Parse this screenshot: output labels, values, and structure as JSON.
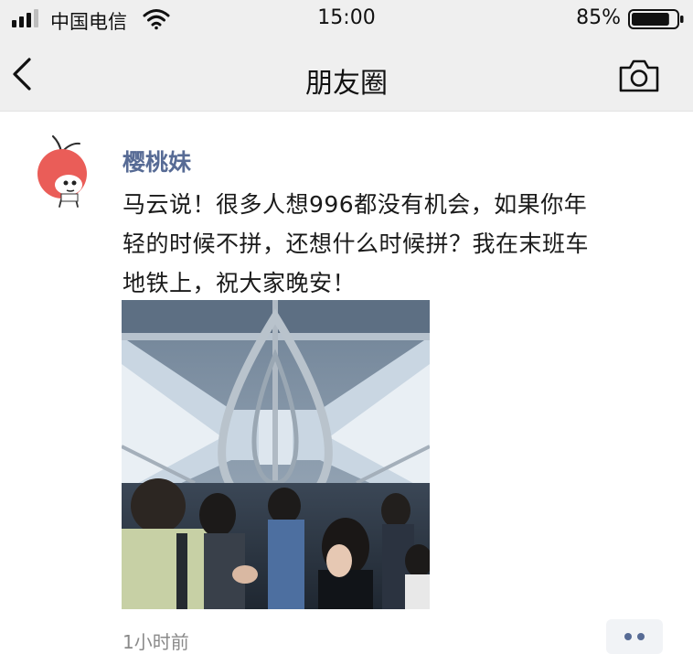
{
  "status_bar": {
    "carrier": "中国电信",
    "time": "15:00",
    "battery_percent": "85%",
    "battery_level": 0.85,
    "icons": [
      "signal-icon",
      "wifi-icon",
      "battery-icon"
    ]
  },
  "nav_bar": {
    "title": "朋友圈",
    "back_icon": "chevron-left-icon",
    "camera_icon": "camera-icon"
  },
  "post": {
    "nickname": "樱桃妹",
    "text_lines": [
      "马云说！很多人想996都没有机会，如果你年",
      "轻的时候不拼，还想什么时候拼？我在末班车",
      "地铁上，祝大家晚安！"
    ],
    "timestamp": "1小时前",
    "more_icon": "more-dots-icon"
  },
  "colors": {
    "nickname": "#576b95",
    "chrome_background": "#efefef",
    "timestamp": "#8a8a8a"
  }
}
